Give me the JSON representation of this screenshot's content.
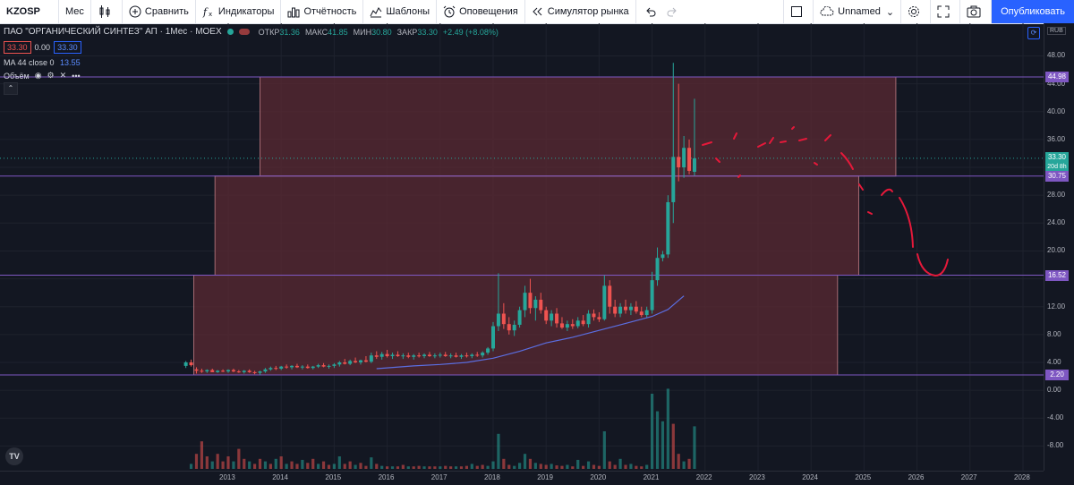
{
  "toolbar": {
    "symbol": "KZOSP",
    "interval": "Мес",
    "compare": "Сравнить",
    "indicators": "Индикаторы",
    "reports": "Отчётность",
    "templates": "Шаблоны",
    "alerts": "Оповещения",
    "simulator": "Симулятор рынка",
    "layout_name": "Unnamed",
    "publish": "Опубликовать"
  },
  "legend": {
    "title": "ПАО \"ОРГАНИЧЕСКИЙ СИНТЕЗ\" АП · 1Мес · MOEX",
    "open_label": "ОТКР",
    "open": "31.36",
    "high_label": "МАКС",
    "high": "41.85",
    "low_label": "МИН",
    "low": "30.80",
    "close_label": "ЗАКР",
    "close": "33.30",
    "change": "+2.49 (+8.08%)",
    "bid": "33.30",
    "spread": "0.00",
    "ask": "33.30",
    "ma_label": "MA 44 close 0",
    "ma_value": "13.55",
    "volume_label": "Объём"
  },
  "currency": "RUB",
  "colors": {
    "up": "#26a69a",
    "down": "#ef5350",
    "ma": "#5b6ee1",
    "zone": "#5b2a33",
    "level": "#7e57c2",
    "drawing": "#e5193a"
  },
  "price_tags": {
    "level1": "44.98",
    "last": "33.30",
    "countdown": "20d 8h",
    "level2": "30.75",
    "level3": "16.52",
    "level4": "2.20"
  },
  "chart_data": {
    "type": "candlestick",
    "y_ticks": [
      "48.00",
      "44.00",
      "40.00",
      "36.00",
      "32.00",
      "28.00",
      "24.00",
      "20.00",
      "16.00",
      "12.00",
      "8.00",
      "4.00",
      "0.00",
      "-4.00",
      "-8.00"
    ],
    "x_ticks": [
      "2013",
      "2014",
      "2015",
      "2016",
      "2017",
      "2018",
      "2019",
      "2020",
      "2021",
      "2022",
      "2023",
      "2024",
      "2025",
      "2026",
      "2027",
      "2028"
    ],
    "ylim": [
      -12.5,
      51
    ],
    "zones": [
      {
        "from_year": 2013.6,
        "to_year": 2025.6,
        "low": 30.75,
        "high": 44.98
      },
      {
        "from_year": 2012.75,
        "to_year": 2024.9,
        "low": 16.52,
        "high": 30.75
      },
      {
        "from_year": 2012.35,
        "to_year": 2024.5,
        "low": 2.2,
        "high": 16.52
      }
    ],
    "levels": [
      44.98,
      30.75,
      16.52,
      2.2
    ],
    "candles": [
      [
        2012.2,
        3.5,
        4.2,
        3.2,
        4.0
      ],
      [
        2012.3,
        4.0,
        4.4,
        3.4,
        3.6
      ],
      [
        2012.4,
        3.0,
        3.3,
        2.4,
        2.8
      ],
      [
        2012.5,
        2.8,
        3.1,
        2.5,
        2.7
      ],
      [
        2012.6,
        2.7,
        3.0,
        2.5,
        2.9
      ],
      [
        2012.7,
        2.9,
        3.1,
        2.6,
        2.6
      ],
      [
        2012.8,
        2.6,
        2.9,
        2.5,
        2.8
      ],
      [
        2012.9,
        2.8,
        3.0,
        2.6,
        2.7
      ],
      [
        2013.0,
        2.7,
        3.0,
        2.5,
        2.9
      ],
      [
        2013.1,
        2.9,
        3.1,
        2.6,
        2.7
      ],
      [
        2013.2,
        2.7,
        2.9,
        2.5,
        2.6
      ],
      [
        2013.3,
        2.6,
        2.9,
        2.4,
        2.8
      ],
      [
        2013.4,
        2.8,
        3.0,
        2.5,
        2.6
      ],
      [
        2013.5,
        2.6,
        2.8,
        2.3,
        2.5
      ],
      [
        2013.6,
        2.5,
        2.8,
        2.2,
        2.7
      ],
      [
        2013.7,
        2.7,
        3.2,
        2.5,
        3.0
      ],
      [
        2013.8,
        3.0,
        3.4,
        2.8,
        3.2
      ],
      [
        2013.9,
        3.2,
        3.5,
        2.9,
        3.1
      ],
      [
        2014.0,
        3.1,
        3.5,
        2.9,
        3.4
      ],
      [
        2014.1,
        3.4,
        3.7,
        3.1,
        3.3
      ],
      [
        2014.2,
        3.3,
        3.6,
        3.0,
        3.5
      ],
      [
        2014.3,
        3.5,
        3.8,
        3.2,
        3.3
      ],
      [
        2014.4,
        3.3,
        3.6,
        3.0,
        3.4
      ],
      [
        2014.5,
        3.4,
        3.7,
        3.1,
        3.2
      ],
      [
        2014.6,
        3.2,
        3.5,
        3.0,
        3.4
      ],
      [
        2014.7,
        3.4,
        3.8,
        3.2,
        3.6
      ],
      [
        2014.8,
        3.6,
        3.9,
        3.3,
        3.4
      ],
      [
        2014.9,
        3.4,
        3.7,
        3.1,
        3.5
      ],
      [
        2015.0,
        3.5,
        3.9,
        3.2,
        3.7
      ],
      [
        2015.1,
        3.7,
        4.2,
        3.4,
        4.0
      ],
      [
        2015.2,
        4.0,
        4.5,
        3.7,
        3.8
      ],
      [
        2015.3,
        3.8,
        4.4,
        3.6,
        4.2
      ],
      [
        2015.4,
        4.2,
        4.7,
        3.9,
        4.0
      ],
      [
        2015.5,
        4.0,
        4.4,
        3.7,
        4.3
      ],
      [
        2015.6,
        4.3,
        4.9,
        4.0,
        4.1
      ],
      [
        2015.7,
        4.1,
        5.4,
        3.9,
        5.0
      ],
      [
        2015.8,
        5.0,
        5.6,
        4.5,
        4.8
      ],
      [
        2015.9,
        4.8,
        5.5,
        4.4,
        5.2
      ],
      [
        2016.0,
        5.2,
        5.8,
        4.7,
        4.9
      ],
      [
        2016.1,
        4.9,
        5.4,
        4.5,
        5.1
      ],
      [
        2016.2,
        5.1,
        5.6,
        4.8,
        4.9
      ],
      [
        2016.3,
        4.9,
        5.3,
        4.5,
        5.0
      ],
      [
        2016.4,
        5.0,
        5.4,
        4.6,
        4.8
      ],
      [
        2016.5,
        4.8,
        5.2,
        4.4,
        5.0
      ],
      [
        2016.6,
        5.0,
        5.4,
        4.7,
        4.9
      ],
      [
        2016.7,
        4.9,
        5.3,
        4.6,
        5.1
      ],
      [
        2016.8,
        5.1,
        5.5,
        4.8,
        4.9
      ],
      [
        2016.9,
        4.9,
        5.3,
        4.6,
        5.0
      ],
      [
        2017.0,
        5.0,
        5.4,
        4.7,
        5.1
      ],
      [
        2017.1,
        5.1,
        5.5,
        4.8,
        4.9
      ],
      [
        2017.2,
        4.9,
        5.3,
        4.6,
        5.0
      ],
      [
        2017.3,
        5.0,
        5.4,
        4.7,
        4.8
      ],
      [
        2017.4,
        4.8,
        5.2,
        4.5,
        5.0
      ],
      [
        2017.5,
        5.0,
        5.4,
        4.7,
        4.9
      ],
      [
        2017.6,
        4.9,
        5.3,
        4.6,
        5.1
      ],
      [
        2017.7,
        5.1,
        5.5,
        4.8,
        5.0
      ],
      [
        2017.8,
        5.0,
        5.6,
        4.7,
        5.4
      ],
      [
        2017.9,
        5.4,
        6.2,
        5.1,
        6.0
      ],
      [
        2018.0,
        6.0,
        9.8,
        5.6,
        9.2
      ],
      [
        2018.1,
        9.2,
        16.8,
        8.5,
        11.0
      ],
      [
        2018.2,
        11.0,
        12.5,
        8.8,
        9.5
      ],
      [
        2018.3,
        9.5,
        10.5,
        8.0,
        8.6
      ],
      [
        2018.4,
        8.6,
        10.0,
        7.8,
        9.4
      ],
      [
        2018.5,
        9.4,
        12.0,
        9.0,
        11.5
      ],
      [
        2018.6,
        11.5,
        15.0,
        10.5,
        14.0
      ],
      [
        2018.7,
        14.0,
        16.0,
        11.0,
        11.8
      ],
      [
        2018.8,
        11.8,
        13.5,
        10.0,
        13.0
      ],
      [
        2018.9,
        13.0,
        14.0,
        11.0,
        11.5
      ],
      [
        2019.0,
        11.5,
        12.0,
        9.5,
        10.0
      ],
      [
        2019.1,
        10.0,
        11.5,
        9.2,
        11.0
      ],
      [
        2019.2,
        11.0,
        11.8,
        9.0,
        9.6
      ],
      [
        2019.3,
        9.6,
        10.5,
        8.8,
        9.0
      ],
      [
        2019.4,
        9.0,
        10.0,
        8.5,
        9.5
      ],
      [
        2019.5,
        9.5,
        10.2,
        8.8,
        9.2
      ],
      [
        2019.6,
        9.2,
        10.5,
        8.9,
        10.0
      ],
      [
        2019.7,
        10.0,
        10.8,
        9.2,
        9.5
      ],
      [
        2019.8,
        9.5,
        11.5,
        9.0,
        11.0
      ],
      [
        2019.9,
        11.0,
        11.6,
        10.0,
        10.5
      ],
      [
        2020.0,
        10.5,
        11.2,
        9.8,
        10.2
      ],
      [
        2020.1,
        10.2,
        16.5,
        10.0,
        15.0
      ],
      [
        2020.2,
        15.0,
        15.8,
        11.0,
        12.0
      ],
      [
        2020.3,
        12.0,
        13.0,
        10.5,
        11.0
      ],
      [
        2020.4,
        11.0,
        12.5,
        10.5,
        12.0
      ],
      [
        2020.5,
        12.0,
        13.0,
        11.0,
        11.5
      ],
      [
        2020.6,
        11.5,
        12.5,
        10.8,
        12.0
      ],
      [
        2020.7,
        12.0,
        12.8,
        11.0,
        11.3
      ],
      [
        2020.8,
        11.3,
        12.0,
        10.5,
        10.8
      ],
      [
        2020.9,
        10.8,
        12.0,
        10.4,
        11.5
      ],
      [
        2021.0,
        11.5,
        17.0,
        11.0,
        15.8
      ],
      [
        2021.1,
        15.8,
        20.5,
        15.0,
        19.0
      ],
      [
        2021.2,
        19.0,
        20.0,
        18.5,
        19.5
      ],
      [
        2021.3,
        19.5,
        28.0,
        19.0,
        27.0
      ],
      [
        2021.4,
        27.0,
        47.0,
        24.0,
        33.5
      ],
      [
        2021.5,
        33.5,
        44.0,
        30.0,
        32.0
      ],
      [
        2021.6,
        32.0,
        36.5,
        30.5,
        34.8
      ],
      [
        2021.7,
        34.8,
        36.0,
        31.0,
        31.5
      ],
      [
        2021.8,
        31.36,
        41.85,
        30.8,
        33.3
      ]
    ],
    "ma": [
      [
        2015.8,
        3.1
      ],
      [
        2016.5,
        3.5
      ],
      [
        2017.0,
        3.7
      ],
      [
        2017.5,
        4.0
      ],
      [
        2018.0,
        4.6
      ],
      [
        2018.5,
        5.6
      ],
      [
        2019.0,
        6.8
      ],
      [
        2019.5,
        7.6
      ],
      [
        2020.0,
        8.6
      ],
      [
        2020.5,
        9.6
      ],
      [
        2021.0,
        10.6
      ],
      [
        2021.3,
        11.6
      ],
      [
        2021.6,
        13.55
      ]
    ],
    "volume": [
      [
        2012.3,
        1.0,
        1
      ],
      [
        2012.4,
        3.0,
        0
      ],
      [
        2012.5,
        5.5,
        0
      ],
      [
        2012.6,
        2.5,
        0
      ],
      [
        2012.7,
        1.5,
        1
      ],
      [
        2012.8,
        3.0,
        0
      ],
      [
        2012.9,
        1.5,
        0
      ],
      [
        2013.0,
        2.5,
        0
      ],
      [
        2013.1,
        1.5,
        1
      ],
      [
        2013.2,
        4.0,
        0
      ],
      [
        2013.3,
        2.0,
        0
      ],
      [
        2013.4,
        1.5,
        1
      ],
      [
        2013.5,
        1.0,
        0
      ],
      [
        2013.6,
        2.0,
        0
      ],
      [
        2013.7,
        1.5,
        1
      ],
      [
        2013.8,
        1.0,
        0
      ],
      [
        2013.9,
        2.0,
        1
      ],
      [
        2014.0,
        2.5,
        0
      ],
      [
        2014.1,
        1.0,
        1
      ],
      [
        2014.2,
        1.5,
        0
      ],
      [
        2014.3,
        1.0,
        0
      ],
      [
        2014.4,
        1.8,
        1
      ],
      [
        2014.5,
        1.2,
        0
      ],
      [
        2014.6,
        2.0,
        0
      ],
      [
        2014.7,
        1.0,
        1
      ],
      [
        2014.8,
        1.5,
        0
      ],
      [
        2014.9,
        0.8,
        0
      ],
      [
        2015.0,
        1.0,
        1
      ],
      [
        2015.1,
        2.5,
        1
      ],
      [
        2015.2,
        1.0,
        0
      ],
      [
        2015.3,
        1.5,
        0
      ],
      [
        2015.4,
        0.8,
        1
      ],
      [
        2015.5,
        1.2,
        0
      ],
      [
        2015.6,
        0.6,
        0
      ],
      [
        2015.7,
        2.3,
        1
      ],
      [
        2015.8,
        1.0,
        0
      ],
      [
        2015.9,
        0.6,
        1
      ],
      [
        2016.0,
        0.5,
        0
      ],
      [
        2016.1,
        0.5,
        1
      ],
      [
        2016.2,
        0.5,
        0
      ],
      [
        2016.3,
        0.8,
        0
      ],
      [
        2016.4,
        0.5,
        1
      ],
      [
        2016.5,
        0.5,
        0
      ],
      [
        2016.6,
        0.6,
        0
      ],
      [
        2016.7,
        0.5,
        1
      ],
      [
        2016.8,
        0.5,
        0
      ],
      [
        2016.9,
        0.5,
        0
      ],
      [
        2017.0,
        0.5,
        1
      ],
      [
        2017.1,
        0.6,
        0
      ],
      [
        2017.2,
        0.5,
        0
      ],
      [
        2017.3,
        0.5,
        1
      ],
      [
        2017.4,
        0.5,
        0
      ],
      [
        2017.5,
        0.6,
        0
      ],
      [
        2017.6,
        1.0,
        1
      ],
      [
        2017.7,
        0.6,
        0
      ],
      [
        2017.8,
        0.8,
        0
      ],
      [
        2017.9,
        0.6,
        1
      ],
      [
        2018.0,
        1.5,
        1
      ],
      [
        2018.1,
        7.0,
        1
      ],
      [
        2018.2,
        2.0,
        0
      ],
      [
        2018.3,
        0.8,
        0
      ],
      [
        2018.4,
        0.6,
        1
      ],
      [
        2018.5,
        1.2,
        1
      ],
      [
        2018.6,
        3.0,
        1
      ],
      [
        2018.7,
        2.0,
        0
      ],
      [
        2018.8,
        1.2,
        1
      ],
      [
        2018.9,
        1.0,
        0
      ],
      [
        2019.0,
        0.8,
        0
      ],
      [
        2019.1,
        1.0,
        1
      ],
      [
        2019.2,
        0.7,
        0
      ],
      [
        2019.3,
        0.6,
        0
      ],
      [
        2019.4,
        0.8,
        1
      ],
      [
        2019.5,
        0.5,
        0
      ],
      [
        2019.6,
        1.8,
        1
      ],
      [
        2019.7,
        0.6,
        0
      ],
      [
        2019.8,
        1.5,
        1
      ],
      [
        2019.9,
        0.8,
        0
      ],
      [
        2020.0,
        0.6,
        0
      ],
      [
        2020.1,
        7.5,
        1
      ],
      [
        2020.2,
        1.5,
        0
      ],
      [
        2020.3,
        0.8,
        0
      ],
      [
        2020.4,
        2.0,
        1
      ],
      [
        2020.5,
        0.8,
        0
      ],
      [
        2020.6,
        1.0,
        1
      ],
      [
        2020.7,
        0.6,
        0
      ],
      [
        2020.8,
        0.5,
        0
      ],
      [
        2020.9,
        0.8,
        1
      ],
      [
        2021.0,
        15.0,
        1
      ],
      [
        2021.1,
        11.5,
        1
      ],
      [
        2021.2,
        9.5,
        1
      ],
      [
        2021.3,
        16.0,
        1
      ],
      [
        2021.4,
        9.0,
        0
      ],
      [
        2021.5,
        3.0,
        0
      ],
      [
        2021.6,
        1.5,
        1
      ],
      [
        2021.7,
        2.0,
        0
      ],
      [
        2021.8,
        8.5,
        1
      ]
    ]
  }
}
